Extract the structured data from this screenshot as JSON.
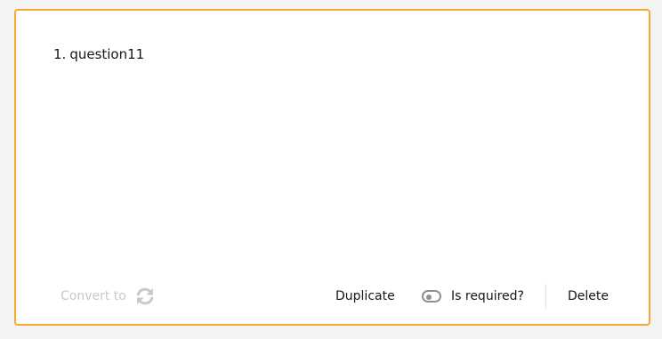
{
  "question": {
    "number": "1.",
    "title": "question11"
  },
  "footer": {
    "convert_label": "Convert to",
    "convert_icon": "refresh-icon",
    "duplicate_label": "Duplicate",
    "required_label": "Is required?",
    "required_on": false,
    "delete_label": "Delete"
  },
  "colors": {
    "accent_border": "#f5a832",
    "disabled_text": "#c8c8c8",
    "toggle": "#909090"
  }
}
